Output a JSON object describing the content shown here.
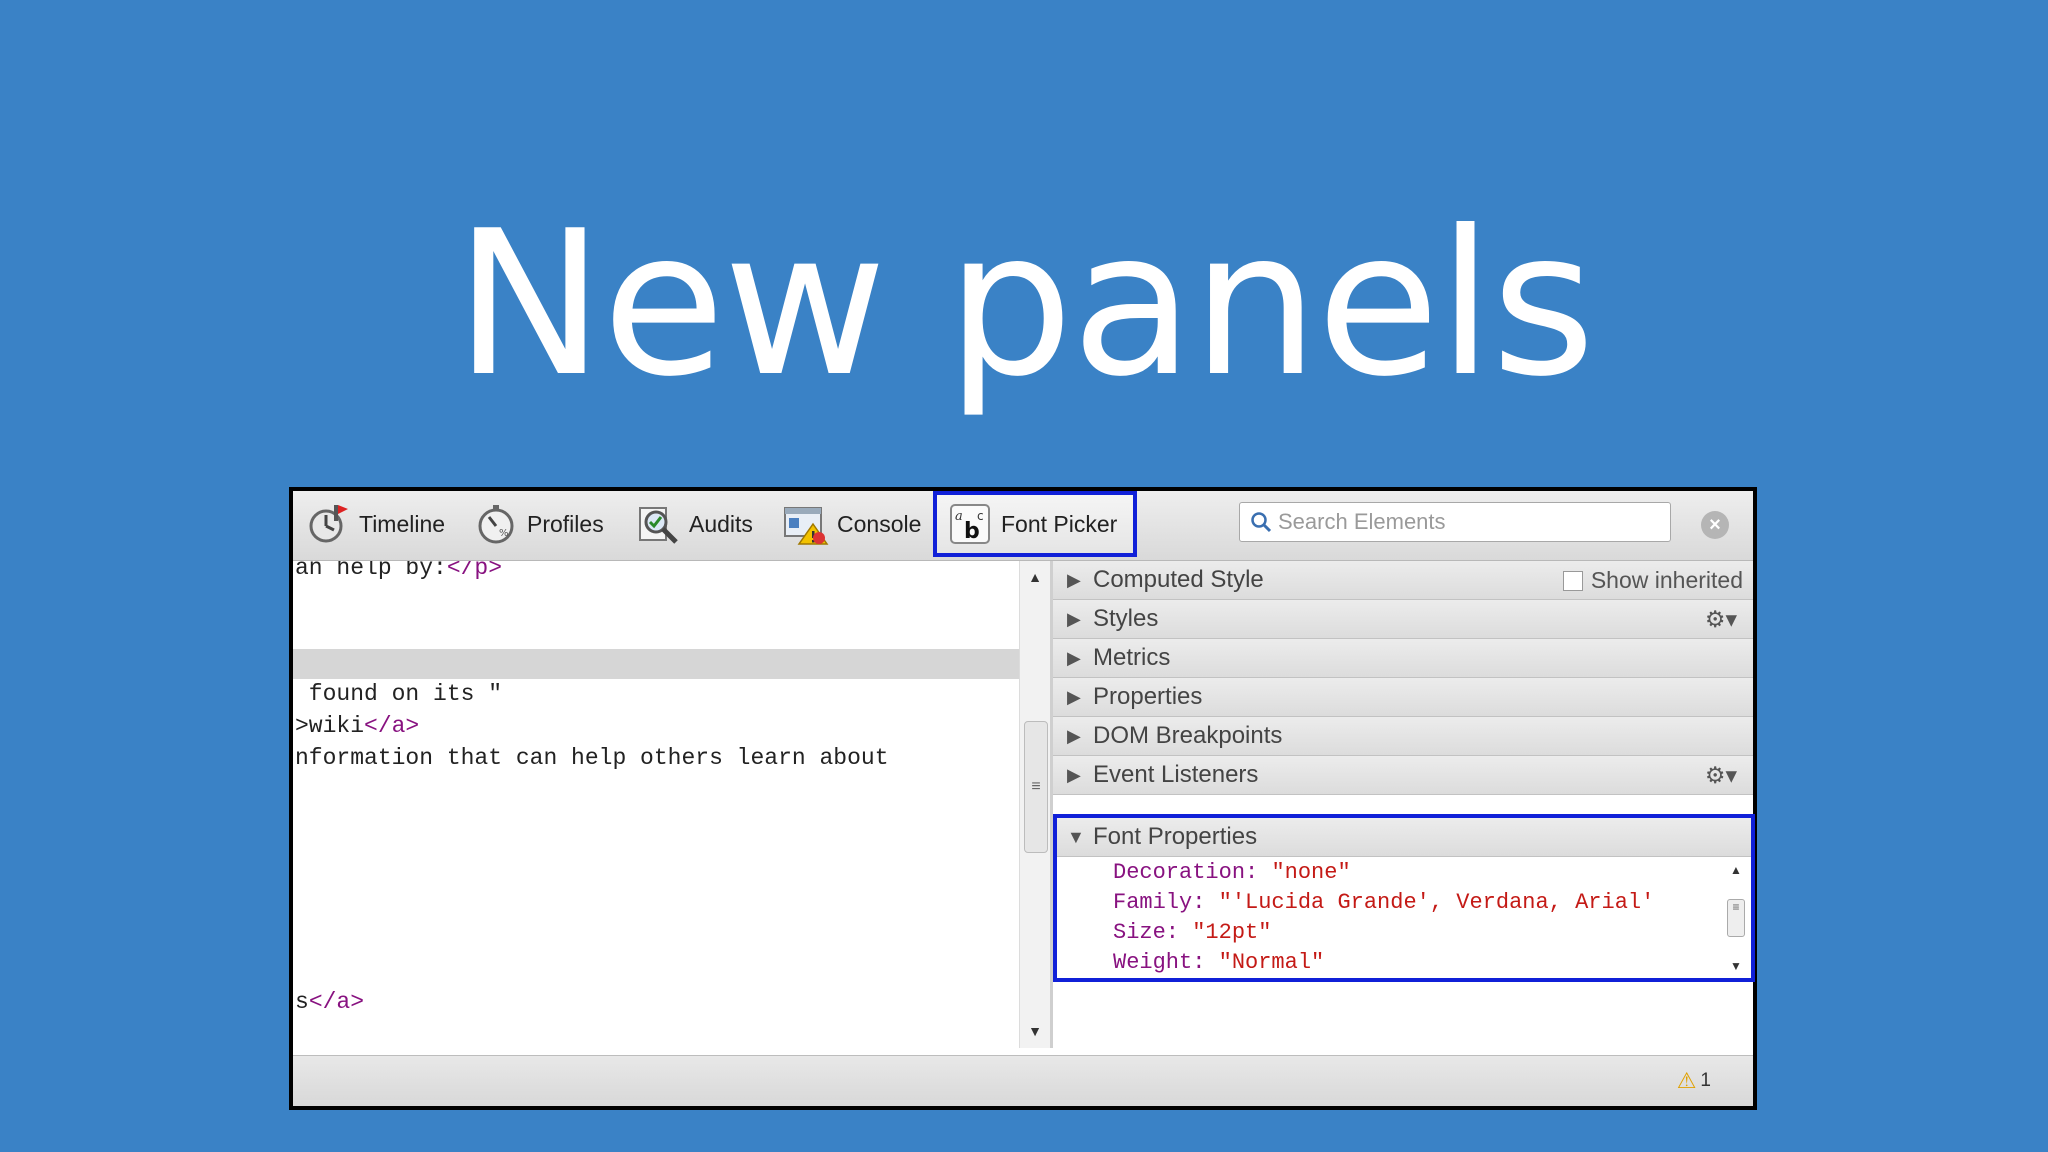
{
  "slide": {
    "title": "New panels"
  },
  "toolbar": {
    "tabs": [
      {
        "label": "Timeline",
        "icon": "timeline-icon"
      },
      {
        "label": "Profiles",
        "icon": "profiles-icon"
      },
      {
        "label": "Audits",
        "icon": "audits-icon"
      },
      {
        "label": "Console",
        "icon": "console-icon"
      },
      {
        "label": "Font Picker",
        "icon": "font-picker-icon",
        "selected": true
      }
    ],
    "search_placeholder": "Search Elements"
  },
  "code_pane": {
    "line1_text": "an help by:",
    "line1_tag": "</p>",
    "line2_text": " found on its \"",
    "line3_pre": ">wiki",
    "line3_tag": "</a>",
    "line4_text": "nformation that can help others learn about",
    "line5_pre": "s",
    "line5_tag": "</a>"
  },
  "sidebar": {
    "computed_style": "Computed Style",
    "show_inherited": "Show inherited",
    "styles": "Styles",
    "metrics": "Metrics",
    "properties": "Properties",
    "dom_breakpoints": "DOM Breakpoints",
    "event_listeners": "Event Listeners",
    "font_properties": "Font Properties"
  },
  "font_properties": {
    "decoration_name": "Decoration:",
    "decoration_value": "\"none\"",
    "family_name": "Family:",
    "family_value": "\"'Lucida Grande', Verdana, Arial'",
    "size_name": "Size:",
    "size_value": "\"12pt\"",
    "weight_name": "Weight:",
    "weight_value": "\"Normal\""
  },
  "status": {
    "warning_count": "1"
  },
  "colors": {
    "background": "#3a82c6",
    "selection_outline": "#1020d8",
    "tag": "#881280",
    "value": "#c41a16"
  }
}
